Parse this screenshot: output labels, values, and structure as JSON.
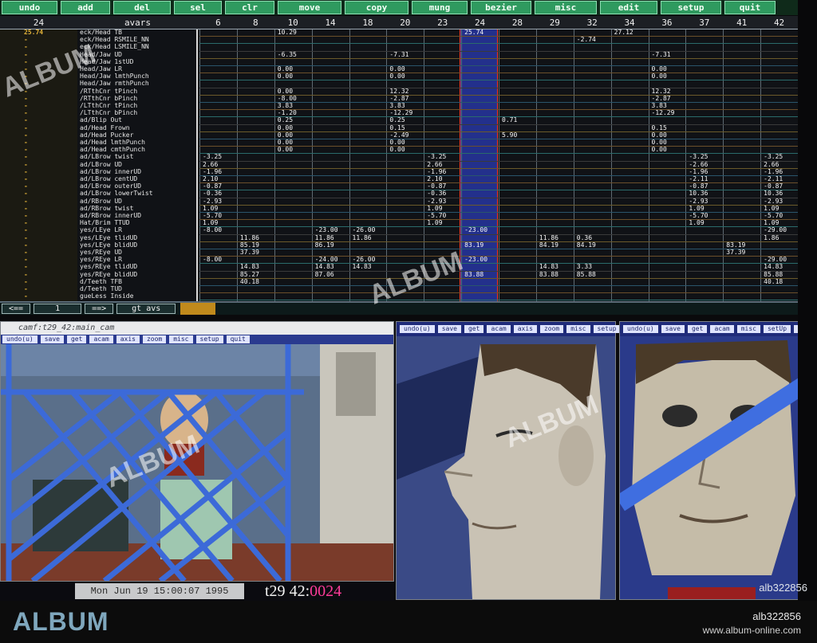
{
  "toolbar": {
    "buttons": [
      "undo",
      "add",
      "del",
      "sel",
      "clr",
      "move",
      "copy",
      "mung",
      "bezier",
      "misc",
      "edit",
      "setup",
      "quit"
    ]
  },
  "sheet": {
    "frame_header": "24",
    "avars_header": "avars",
    "columns": [
      "6",
      "8",
      "10",
      "14",
      "18",
      "20",
      "23",
      "24",
      "28",
      "29",
      "32",
      "34",
      "36",
      "37",
      "41",
      "42"
    ],
    "frames": [
      "25.74",
      "-",
      "-",
      "-",
      "-",
      "-",
      "-",
      "-",
      "-",
      "-",
      "-",
      "-",
      "-",
      "-",
      "-",
      "-",
      "-",
      "-",
      "-",
      "-",
      "-",
      "-",
      "-",
      "-",
      "-",
      "-",
      "-",
      "-",
      "-",
      "-",
      "-",
      "-",
      "-",
      "-",
      "-",
      "-",
      "-",
      "-",
      "-",
      "-",
      "-"
    ],
    "avars": [
      "eck/Head  TB",
      "eck/Head  RSMILE_NN",
      "eck/Head  LSMILE_NN",
      "Head/Jaw  UD",
      "Head/Jaw  1stUD",
      "Head/Jaw  LR",
      "Head/Jaw  lmthPunch",
      "Head/Jaw  rmthPunch",
      "/RTthCnr  tPinch",
      "/RTthCnr  bPinch",
      "/LTthCnr  tPinch",
      "/LTthCnr  bPinch",
      "ad/Blip   Out",
      "ad/Head   Frown",
      "ad/Head   Pucker",
      "ad/Head   lmthPunch",
      "ad/Head   cmthPunch",
      "ad/LBrow  twist",
      "ad/LBrow  UD",
      "ad/LBrow  innerUD",
      "ad/LBrow  centUD",
      "ad/LBrow  outerUD",
      "ad/LBrow  lowerTwist",
      "ad/RBrow  UD",
      "ad/RBrow  twist",
      "ad/RBrow  innerUD",
      "Hat/Brim  TTUD",
      "yes/LEye  LR",
      "yes/LEye  tlidUD",
      "yes/LEye  blidUD",
      "yes/REye  UD",
      "yes/REye  LR",
      "yes/REye  tlidUD",
      "yes/REye  blidUD",
      "d/Teeth   TFB",
      "d/Teeth   TUD",
      "gueLess   Inside"
    ],
    "values": [
      {
        "row": 0,
        "col": 2,
        "v": "10.29"
      },
      {
        "row": 0,
        "col": 7,
        "v": "25.74"
      },
      {
        "row": 0,
        "col": 11,
        "v": "27.12"
      },
      {
        "row": 1,
        "col": 10,
        "v": "-2.74"
      },
      {
        "row": 3,
        "col": 2,
        "v": "-6.35"
      },
      {
        "row": 3,
        "col": 5,
        "v": "-7.31"
      },
      {
        "row": 3,
        "col": 12,
        "v": "-7.31"
      },
      {
        "row": 5,
        "col": 2,
        "v": "0.00"
      },
      {
        "row": 5,
        "col": 5,
        "v": "0.00"
      },
      {
        "row": 5,
        "col": 12,
        "v": "0.00"
      },
      {
        "row": 6,
        "col": 2,
        "v": "0.00"
      },
      {
        "row": 6,
        "col": 5,
        "v": "0.00"
      },
      {
        "row": 6,
        "col": 12,
        "v": "0.00"
      },
      {
        "row": 8,
        "col": 2,
        "v": "0.00"
      },
      {
        "row": 8,
        "col": 5,
        "v": "12.32"
      },
      {
        "row": 8,
        "col": 12,
        "v": "12.32"
      },
      {
        "row": 9,
        "col": 2,
        "v": "-8.00"
      },
      {
        "row": 9,
        "col": 5,
        "v": "-2.87"
      },
      {
        "row": 9,
        "col": 12,
        "v": "-2.87"
      },
      {
        "row": 10,
        "col": 2,
        "v": "3.83"
      },
      {
        "row": 10,
        "col": 5,
        "v": "3.83"
      },
      {
        "row": 10,
        "col": 12,
        "v": "3.83"
      },
      {
        "row": 11,
        "col": 2,
        "v": "-1.20"
      },
      {
        "row": 11,
        "col": 5,
        "v": "-12.29"
      },
      {
        "row": 11,
        "col": 12,
        "v": "-12.29"
      },
      {
        "row": 12,
        "col": 2,
        "v": "0.25"
      },
      {
        "row": 12,
        "col": 5,
        "v": "0.25"
      },
      {
        "row": 12,
        "col": 8,
        "v": "0.71"
      },
      {
        "row": 13,
        "col": 2,
        "v": "0.00"
      },
      {
        "row": 13,
        "col": 5,
        "v": "0.15"
      },
      {
        "row": 13,
        "col": 12,
        "v": "0.15"
      },
      {
        "row": 14,
        "col": 2,
        "v": "0.00"
      },
      {
        "row": 14,
        "col": 5,
        "v": "-2.49"
      },
      {
        "row": 14,
        "col": 8,
        "v": "5.90"
      },
      {
        "row": 14,
        "col": 12,
        "v": "0.00"
      },
      {
        "row": 15,
        "col": 2,
        "v": "0.00"
      },
      {
        "row": 15,
        "col": 5,
        "v": "0.00"
      },
      {
        "row": 15,
        "col": 12,
        "v": "0.00"
      },
      {
        "row": 16,
        "col": 2,
        "v": "0.00"
      },
      {
        "row": 16,
        "col": 5,
        "v": "0.00"
      },
      {
        "row": 16,
        "col": 12,
        "v": "0.00"
      },
      {
        "row": 17,
        "col": 0,
        "v": "-3.25"
      },
      {
        "row": 17,
        "col": 6,
        "v": "-3.25"
      },
      {
        "row": 17,
        "col": 13,
        "v": "-3.25"
      },
      {
        "row": 17,
        "col": 15,
        "v": "-3.25"
      },
      {
        "row": 18,
        "col": 0,
        "v": "2.66"
      },
      {
        "row": 18,
        "col": 6,
        "v": "2.66"
      },
      {
        "row": 18,
        "col": 13,
        "v": "-2.66"
      },
      {
        "row": 18,
        "col": 15,
        "v": "2.66"
      },
      {
        "row": 19,
        "col": 0,
        "v": "-1.96"
      },
      {
        "row": 19,
        "col": 6,
        "v": "-1.96"
      },
      {
        "row": 19,
        "col": 13,
        "v": "-1.96"
      },
      {
        "row": 19,
        "col": 15,
        "v": "-1.96"
      },
      {
        "row": 20,
        "col": 0,
        "v": "2.10"
      },
      {
        "row": 20,
        "col": 6,
        "v": "2.10"
      },
      {
        "row": 20,
        "col": 13,
        "v": "-2.11"
      },
      {
        "row": 20,
        "col": 15,
        "v": "-2.11"
      },
      {
        "row": 21,
        "col": 0,
        "v": "-0.87"
      },
      {
        "row": 21,
        "col": 6,
        "v": "-0.87"
      },
      {
        "row": 21,
        "col": 13,
        "v": "-0.87"
      },
      {
        "row": 21,
        "col": 15,
        "v": "-0.87"
      },
      {
        "row": 22,
        "col": 0,
        "v": "-0.36"
      },
      {
        "row": 22,
        "col": 6,
        "v": "-0.36"
      },
      {
        "row": 22,
        "col": 13,
        "v": "10.36"
      },
      {
        "row": 22,
        "col": 15,
        "v": "10.36"
      },
      {
        "row": 23,
        "col": 0,
        "v": "-2.93"
      },
      {
        "row": 23,
        "col": 6,
        "v": "-2.93"
      },
      {
        "row": 23,
        "col": 13,
        "v": "-2.93"
      },
      {
        "row": 23,
        "col": 15,
        "v": "-2.93"
      },
      {
        "row": 24,
        "col": 0,
        "v": "1.09"
      },
      {
        "row": 24,
        "col": 6,
        "v": "1.09"
      },
      {
        "row": 24,
        "col": 13,
        "v": "1.09"
      },
      {
        "row": 24,
        "col": 15,
        "v": "1.09"
      },
      {
        "row": 25,
        "col": 0,
        "v": "-5.70"
      },
      {
        "row": 25,
        "col": 6,
        "v": "-5.70"
      },
      {
        "row": 25,
        "col": 13,
        "v": "-5.70"
      },
      {
        "row": 25,
        "col": 15,
        "v": "-5.70"
      },
      {
        "row": 26,
        "col": 0,
        "v": "1.09"
      },
      {
        "row": 26,
        "col": 6,
        "v": "1.09"
      },
      {
        "row": 26,
        "col": 13,
        "v": "1.09"
      },
      {
        "row": 26,
        "col": 15,
        "v": "1.09"
      },
      {
        "row": 27,
        "col": 0,
        "v": "-8.00"
      },
      {
        "row": 27,
        "col": 3,
        "v": "-23.00"
      },
      {
        "row": 27,
        "col": 4,
        "v": "-26.00"
      },
      {
        "row": 27,
        "col": 7,
        "v": "-23.00"
      },
      {
        "row": 27,
        "col": 15,
        "v": "-29.00"
      },
      {
        "row": 28,
        "col": 1,
        "v": "11.86"
      },
      {
        "row": 28,
        "col": 3,
        "v": "11.86"
      },
      {
        "row": 28,
        "col": 4,
        "v": "11.86"
      },
      {
        "row": 28,
        "col": 9,
        "v": "11.86"
      },
      {
        "row": 28,
        "col": 10,
        "v": "0.36"
      },
      {
        "row": 28,
        "col": 15,
        "v": "1.86"
      },
      {
        "row": 29,
        "col": 1,
        "v": "85.19"
      },
      {
        "row": 29,
        "col": 3,
        "v": "86.19"
      },
      {
        "row": 29,
        "col": 7,
        "v": "83.19"
      },
      {
        "row": 29,
        "col": 9,
        "v": "84.19"
      },
      {
        "row": 29,
        "col": 10,
        "v": "84.19"
      },
      {
        "row": 29,
        "col": 14,
        "v": "83.19"
      },
      {
        "row": 30,
        "col": 1,
        "v": "37.39"
      },
      {
        "row": 30,
        "col": 14,
        "v": "37.39"
      },
      {
        "row": 31,
        "col": 0,
        "v": "-8.00"
      },
      {
        "row": 31,
        "col": 3,
        "v": "-24.00"
      },
      {
        "row": 31,
        "col": 4,
        "v": "-26.00"
      },
      {
        "row": 31,
        "col": 7,
        "v": "-23.00"
      },
      {
        "row": 31,
        "col": 15,
        "v": "-29.00"
      },
      {
        "row": 32,
        "col": 1,
        "v": "14.83"
      },
      {
        "row": 32,
        "col": 3,
        "v": "14.83"
      },
      {
        "row": 32,
        "col": 4,
        "v": "14.83"
      },
      {
        "row": 32,
        "col": 9,
        "v": "14.83"
      },
      {
        "row": 32,
        "col": 10,
        "v": "3.33"
      },
      {
        "row": 32,
        "col": 15,
        "v": "14.83"
      },
      {
        "row": 33,
        "col": 1,
        "v": "85.27"
      },
      {
        "row": 33,
        "col": 3,
        "v": "87.06"
      },
      {
        "row": 33,
        "col": 7,
        "v": "83.88"
      },
      {
        "row": 33,
        "col": 9,
        "v": "83.88"
      },
      {
        "row": 33,
        "col": 10,
        "v": "85.88"
      },
      {
        "row": 33,
        "col": 15,
        "v": "85.88"
      },
      {
        "row": 34,
        "col": 1,
        "v": "40.18"
      },
      {
        "row": 34,
        "col": 15,
        "v": "40.18"
      }
    ],
    "nav": {
      "prev": "<==",
      "frame_field": "1",
      "next": "==>",
      "goto": "gt avs"
    }
  },
  "camera_window": {
    "title": "camf:t29_42:main_cam",
    "buttons": [
      "undo(u)",
      "save",
      "get",
      "acam",
      "axis",
      "zoom",
      "misc",
      "setup",
      "quit"
    ]
  },
  "face_left": {
    "buttons": [
      "undo(u)",
      "save",
      "get",
      "acam",
      "axis",
      "zoom",
      "misc",
      "setup",
      "quit"
    ]
  },
  "face_right": {
    "buttons": [
      "undo(u)",
      "save",
      "get",
      "acam",
      "misc",
      "setUp",
      "quit"
    ]
  },
  "status": {
    "datetime": "Mon Jun 19 15:00:07 1995",
    "shot_label": "t29",
    "shot_num": "42:",
    "frame_num": "0024"
  },
  "watermark": {
    "logo": "ALBUM",
    "image_id": "alb322856",
    "url": "www.album-online.com",
    "stamp": "alb322856"
  },
  "colors": {
    "toolbar_green": "#2f9a5f",
    "frame_amber": "#e3b33a",
    "hilite_blue": "#23308c",
    "hilite_red": "#ff3a2a",
    "frame_pink": "#ff3b9a"
  }
}
